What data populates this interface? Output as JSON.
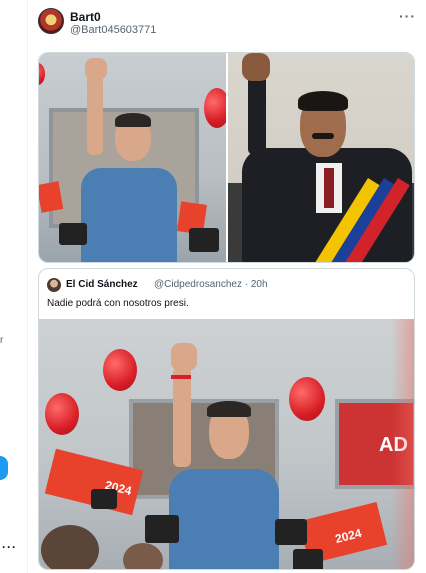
{
  "tweet": {
    "author_name": "Bart0",
    "author_handle": "@Bart045603771",
    "more_label": "···"
  },
  "quoted_tweet": {
    "author_name": "El Cid Sánchez",
    "author_handle": "@Cidpedrosanchez · 20h",
    "text": "Nadie podrá con nosotros presi."
  },
  "photo_signs": {
    "sign_2024_a": "2024",
    "sign_2024_b": "2024",
    "sign_ad": "AD"
  },
  "gutter": {
    "glyph": "r",
    "more_label": "···"
  },
  "colors": {
    "accent_blue": "#1d9bf0",
    "border": "#cfd9de",
    "secondary_text": "#536471",
    "psoe_red": "#e8412c"
  }
}
